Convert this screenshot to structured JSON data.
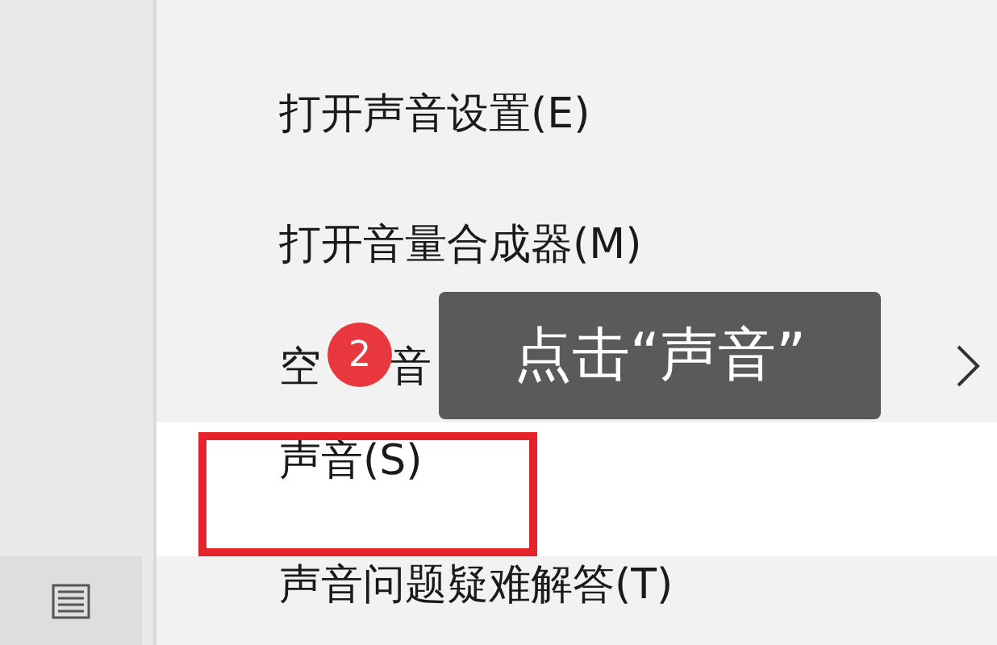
{
  "menu": {
    "items": [
      {
        "label": "打开声音设置(E)",
        "selected": false,
        "submenu": false,
        "outlined": false
      },
      {
        "label": "打开音量合成器(M)",
        "selected": false,
        "submenu": false,
        "outlined": false
      },
      {
        "label": "空　  音",
        "selected": false,
        "submenu": true,
        "outlined": false
      },
      {
        "label": "声音(S)",
        "selected": true,
        "submenu": false,
        "outlined": true
      },
      {
        "label": "声音问题疑难解答(T)",
        "selected": false,
        "submenu": false,
        "outlined": false
      }
    ]
  },
  "callout": {
    "step": "2",
    "text": "点击“声音”"
  }
}
